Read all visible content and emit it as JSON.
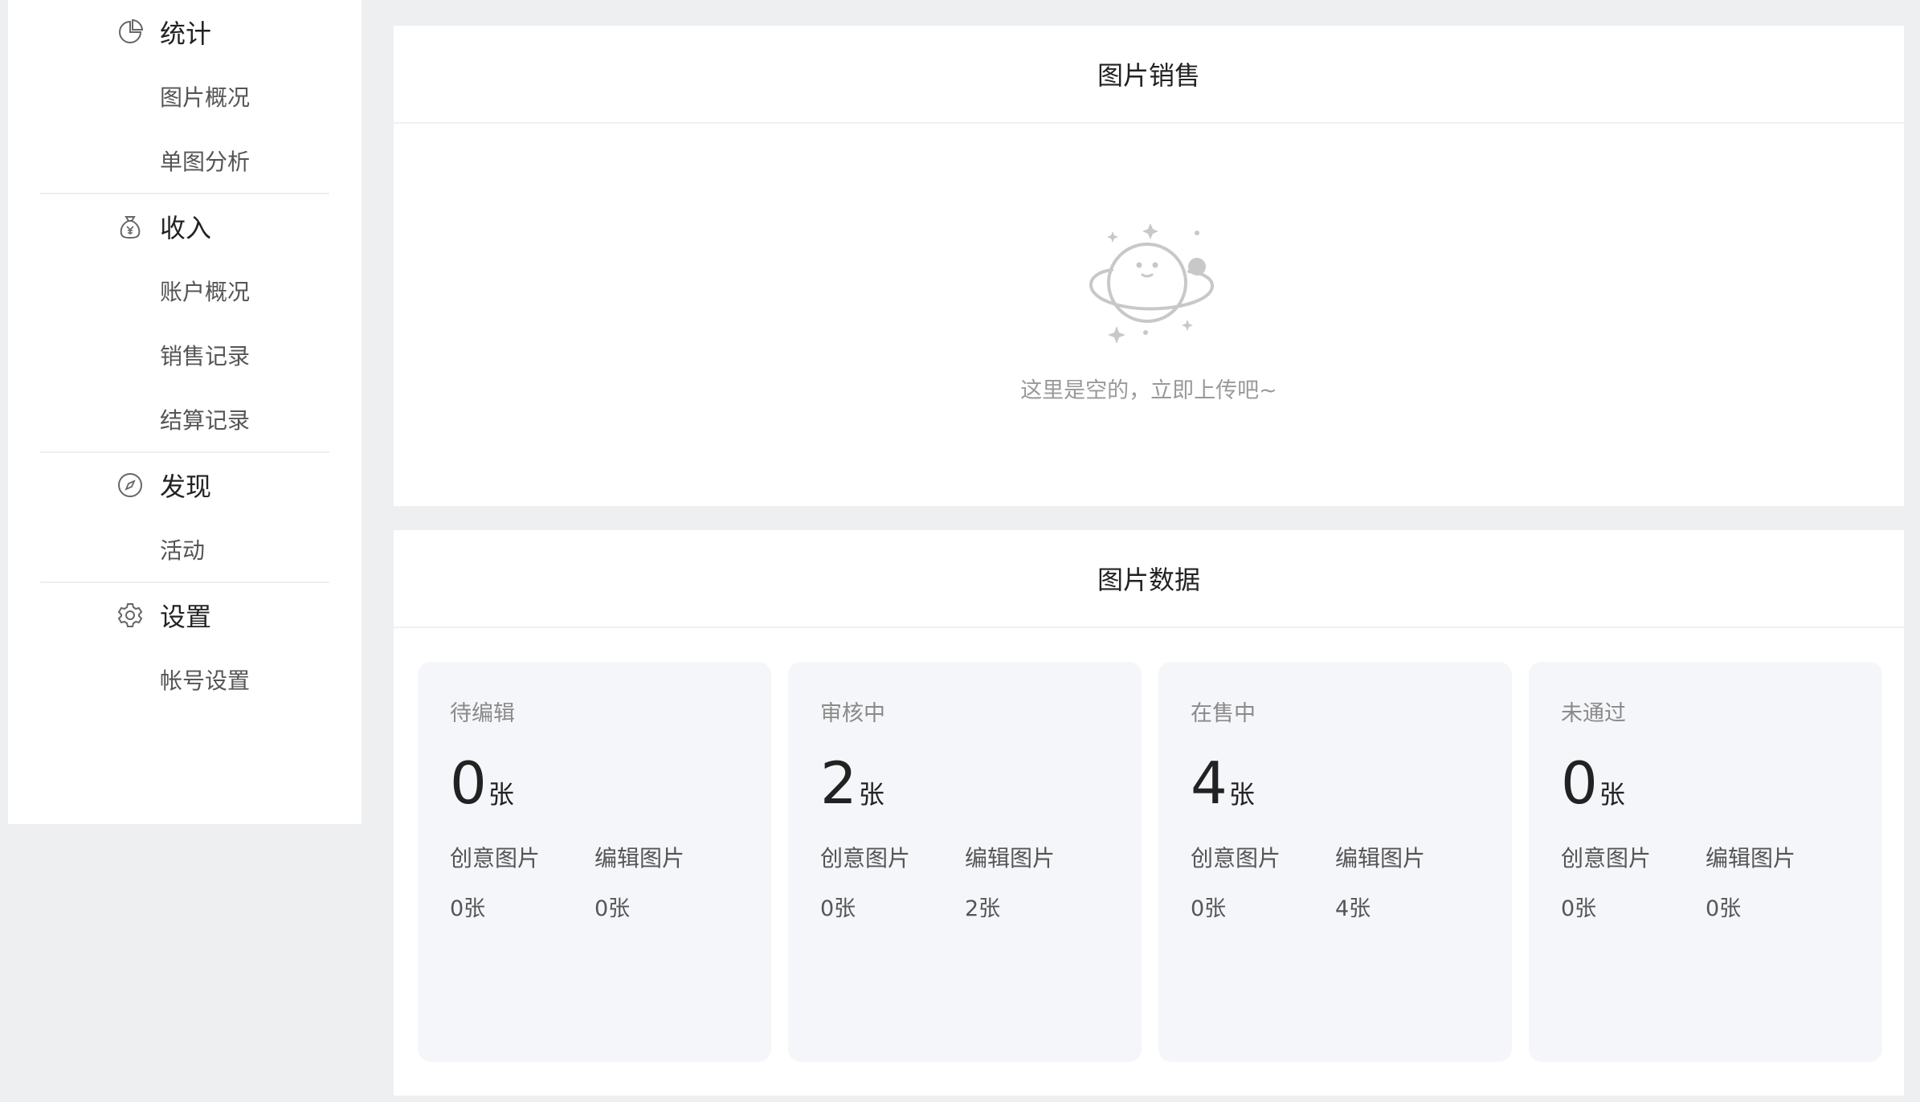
{
  "sidebar": {
    "groups": [
      {
        "title": "统计",
        "icon": "pie-chart-icon",
        "items": [
          "图片概况",
          "单图分析"
        ]
      },
      {
        "title": "收入",
        "icon": "money-bag-icon",
        "items": [
          "账户概况",
          "销售记录",
          "结算记录"
        ]
      },
      {
        "title": "发现",
        "icon": "compass-icon",
        "items": [
          "活动"
        ]
      },
      {
        "title": "设置",
        "icon": "gear-icon",
        "items": [
          "帐号设置"
        ]
      }
    ]
  },
  "sales_panel": {
    "title": "图片销售",
    "empty_text": "这里是空的，立即上传吧~"
  },
  "data_panel": {
    "title": "图片数据",
    "cards": [
      {
        "label": "待编辑",
        "count": "0",
        "unit": "张",
        "creative_label": "创意图片",
        "creative_value": "0张",
        "editorial_label": "编辑图片",
        "editorial_value": "0张"
      },
      {
        "label": "审核中",
        "count": "2",
        "unit": "张",
        "creative_label": "创意图片",
        "creative_value": "0张",
        "editorial_label": "编辑图片",
        "editorial_value": "2张"
      },
      {
        "label": "在售中",
        "count": "4",
        "unit": "张",
        "creative_label": "创意图片",
        "creative_value": "0张",
        "editorial_label": "编辑图片",
        "editorial_value": "4张"
      },
      {
        "label": "未通过",
        "count": "0",
        "unit": "张",
        "creative_label": "创意图片",
        "creative_value": "0张",
        "editorial_label": "编辑图片",
        "editorial_value": "0张"
      }
    ]
  },
  "colors": {
    "page_bg": "#eeeff1",
    "panel_bg": "#ffffff",
    "card_bg": "#f5f6fa",
    "muted_text": "#999999"
  }
}
